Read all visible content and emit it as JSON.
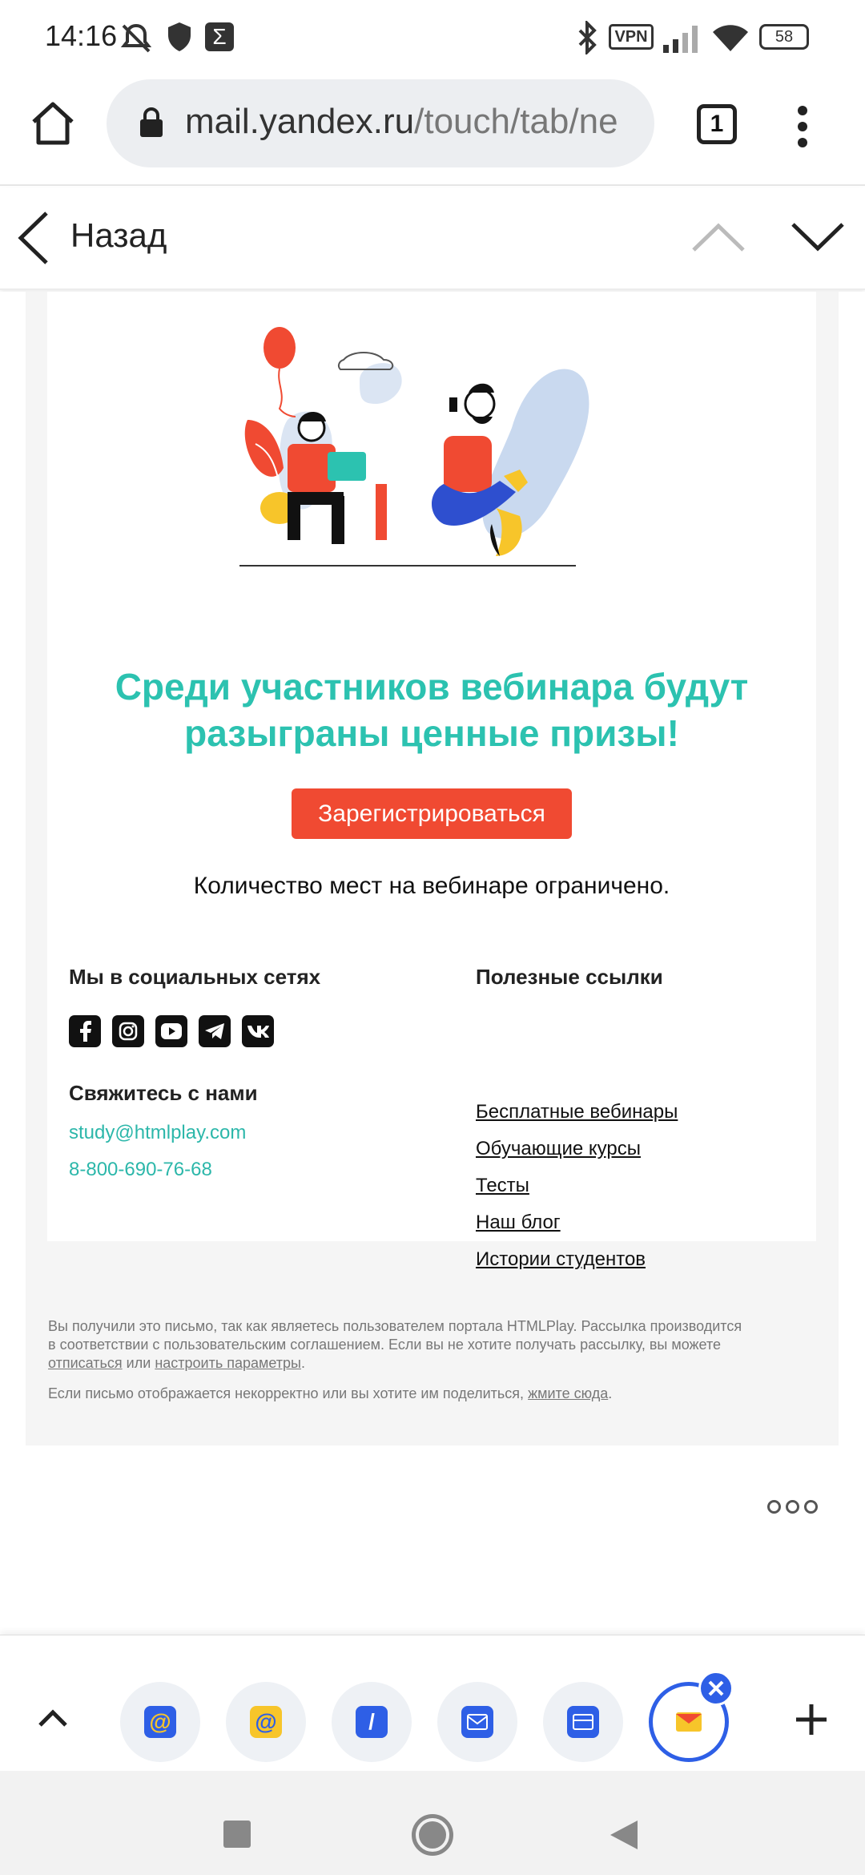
{
  "status_bar": {
    "time": "14:16",
    "vpn": "VPN",
    "battery": "58"
  },
  "browser": {
    "url_host": "mail.yandex.ru",
    "url_path": "/touch/tab/ne",
    "tab_count": "1"
  },
  "nav": {
    "back_label": "Назад"
  },
  "email": {
    "headline_line1": "Среди участников вебинара будут",
    "headline_line2": "разыграны ценные призы!",
    "register_button": "Зарегистрироваться",
    "limited_text": "Количество мест на вебинаре ограничено.",
    "social_heading": "Мы в социальных сетях",
    "social_icons": [
      "facebook-icon",
      "instagram-icon",
      "youtube-icon",
      "telegram-icon",
      "vk-icon"
    ],
    "contact_heading": "Свяжитесь с нами",
    "contact_email": "study@htmlplay.com",
    "contact_phone": "8-800-690-76-68",
    "links_heading": "Полезные ссылки",
    "links": [
      "Бесплатные вебинары",
      "Обучающие курсы",
      "Тесты",
      "Наш блог",
      "Истории студентов"
    ],
    "disclaimer": {
      "line1": "Вы получили это письмо, так как являетесь пользователем портала HTMLPlay. Рассылка производится",
      "line2": "в соответствии с пользовательским соглашением. Если вы не хотите получать рассылку, вы можете",
      "unsubscribe": "отписаться",
      "or": "или",
      "settings": "настроить параметры",
      "period": ".",
      "line3": "Если письмо отображается некорректно или вы хотите им поделиться,",
      "click_here": "жмите сюда"
    }
  },
  "colors": {
    "accent_teal": "#2cc2b0",
    "button_red": "#f04a32",
    "tab_blue": "#2e5fe6"
  }
}
